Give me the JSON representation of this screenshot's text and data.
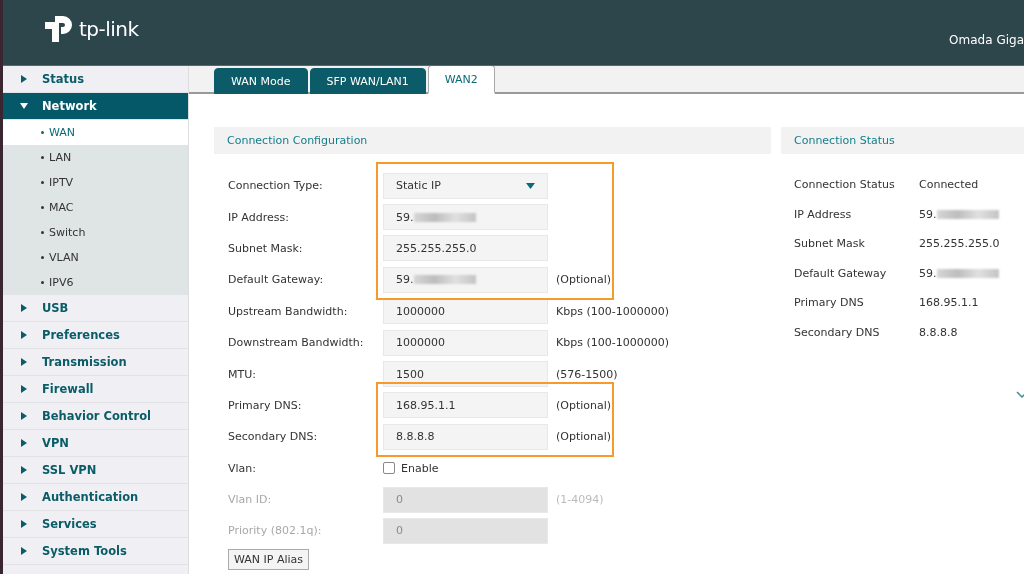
{
  "header": {
    "logo_text": "tp-link",
    "device_name": "Omada Giga"
  },
  "sidebar": {
    "items": [
      {
        "label": "Status",
        "expanded": false,
        "selected": false
      },
      {
        "label": "Network",
        "expanded": true,
        "selected": true,
        "children": [
          {
            "label": "WAN",
            "selected": true
          },
          {
            "label": "LAN",
            "selected": false
          },
          {
            "label": "IPTV",
            "selected": false
          },
          {
            "label": "MAC",
            "selected": false
          },
          {
            "label": "Switch",
            "selected": false
          },
          {
            "label": "VLAN",
            "selected": false
          },
          {
            "label": "IPV6",
            "selected": false
          }
        ]
      },
      {
        "label": "USB",
        "expanded": false,
        "selected": false
      },
      {
        "label": "Preferences",
        "expanded": false,
        "selected": false
      },
      {
        "label": "Transmission",
        "expanded": false,
        "selected": false
      },
      {
        "label": "Firewall",
        "expanded": false,
        "selected": false
      },
      {
        "label": "Behavior Control",
        "expanded": false,
        "selected": false
      },
      {
        "label": "VPN",
        "expanded": false,
        "selected": false
      },
      {
        "label": "SSL VPN",
        "expanded": false,
        "selected": false
      },
      {
        "label": "Authentication",
        "expanded": false,
        "selected": false
      },
      {
        "label": "Services",
        "expanded": false,
        "selected": false
      },
      {
        "label": "System Tools",
        "expanded": false,
        "selected": false
      }
    ]
  },
  "tabs": [
    {
      "label": "WAN Mode",
      "selected": false
    },
    {
      "label": "SFP WAN/LAN1",
      "selected": false
    },
    {
      "label": "WAN2",
      "selected": true
    }
  ],
  "config": {
    "title": "Connection Configuration",
    "rows": [
      {
        "kind": "select",
        "label": "Connection Type:",
        "value": "Static IP",
        "highlighted": true
      },
      {
        "kind": "input",
        "label": "IP Address:",
        "value": "59.",
        "redacted": true,
        "highlighted": true
      },
      {
        "kind": "input",
        "label": "Subnet Mask:",
        "value": "255.255.255.0",
        "highlighted": true
      },
      {
        "kind": "input",
        "label": "Default Gateway:",
        "value": "59.",
        "redacted": true,
        "hint": "(Optional)",
        "highlighted": true
      },
      {
        "kind": "input",
        "label": "Upstream Bandwidth:",
        "value": "1000000",
        "hint": "Kbps (100-1000000)"
      },
      {
        "kind": "input",
        "label": "Downstream Bandwidth:",
        "value": "1000000",
        "hint": "Kbps (100-1000000)"
      },
      {
        "kind": "input",
        "label": "MTU:",
        "value": "1500",
        "hint": "(576-1500)"
      },
      {
        "kind": "input",
        "label": "Primary DNS:",
        "value": "168.95.1.1",
        "hint": "(Optional)",
        "highlighted": true
      },
      {
        "kind": "input",
        "label": "Secondary DNS:",
        "value": "8.8.8.8",
        "hint": "(Optional)",
        "highlighted": true
      },
      {
        "kind": "checkbox",
        "label": "Vlan:",
        "option": "Enable",
        "checked": false
      },
      {
        "kind": "input",
        "label": "Vlan ID:",
        "value": "0",
        "hint": "(1-4094)",
        "disabled": true
      },
      {
        "kind": "input",
        "label": "Priority (802.1q):",
        "value": "0",
        "disabled": true
      }
    ],
    "button": "WAN IP Alias"
  },
  "status": {
    "title": "Connection Status",
    "rows": [
      {
        "label": "Connection Status",
        "value": "Connected"
      },
      {
        "label": "IP Address",
        "value": "59.",
        "redacted": true
      },
      {
        "label": "Subnet Mask",
        "value": "255.255.255.0"
      },
      {
        "label": "Default Gateway",
        "value": "59.",
        "redacted": true
      },
      {
        "label": "Primary DNS",
        "value": "168.95.1.1"
      },
      {
        "label": "Secondary DNS",
        "value": "8.8.8.8"
      }
    ]
  }
}
